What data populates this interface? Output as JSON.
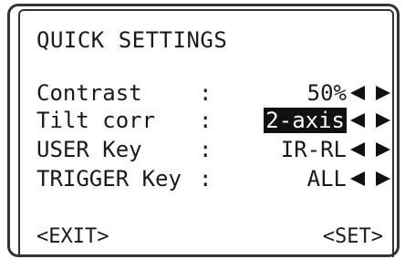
{
  "screen": {
    "title": "QUICK SETTINGS"
  },
  "settings": [
    {
      "label": "Contrast",
      "colon": ":",
      "value": "50%",
      "selected": false,
      "arrows_icon": "left-right-arrows"
    },
    {
      "label": "Tilt corr",
      "colon": ":",
      "value": "2-axis",
      "selected": true,
      "arrows_icon": "left-right-arrows"
    },
    {
      "label": "USER Key",
      "colon": ":",
      "value": "IR-RL",
      "selected": false,
      "arrows_icon": "left-right-arrows"
    },
    {
      "label": "TRIGGER Key",
      "colon": ":",
      "value": "ALL",
      "selected": false,
      "arrows_icon": "left-right-arrows"
    }
  ],
  "softkeys": {
    "left": "<EXIT>",
    "right": "<SET>"
  },
  "colors": {
    "text": "#1a1a1a",
    "highlight_bg": "#111111",
    "highlight_text": "#ffffff",
    "background": "#ffffff"
  }
}
